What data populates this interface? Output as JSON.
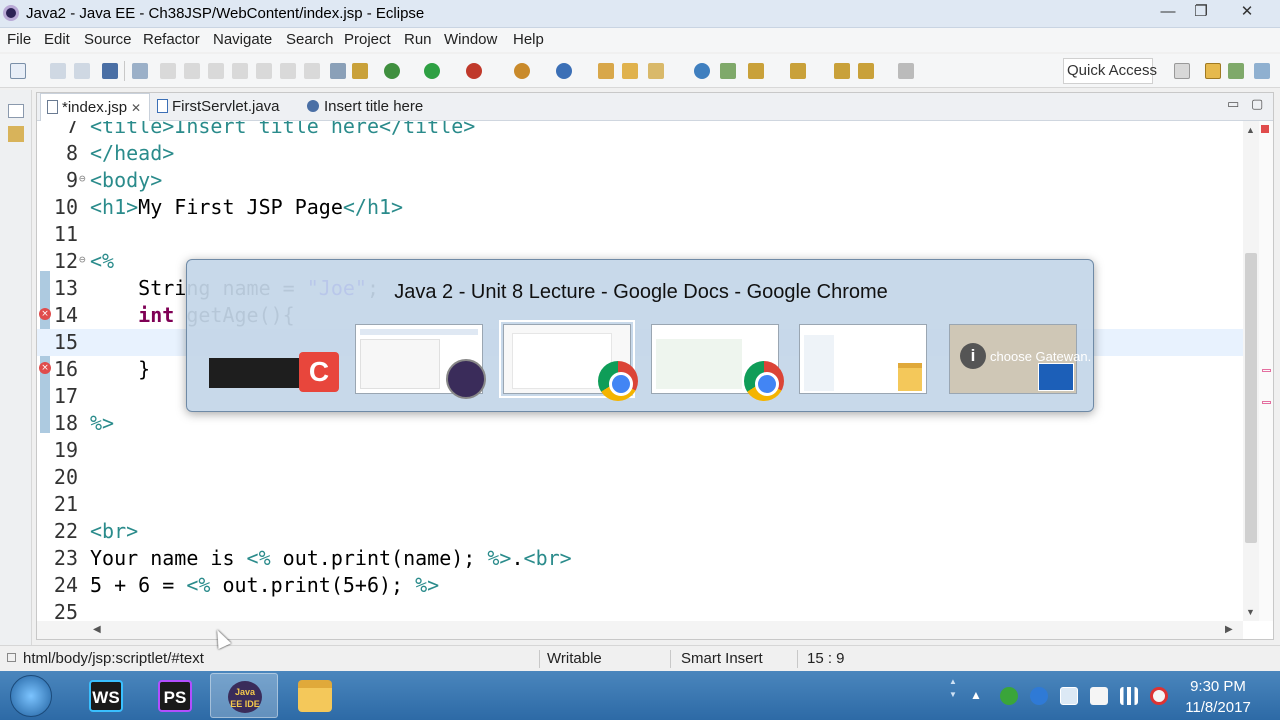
{
  "window": {
    "title": "Java2 - Java EE - Ch38JSP/WebContent/index.jsp - Eclipse",
    "controls": {
      "minimize": "—",
      "maximize": "❐",
      "close": "✕"
    }
  },
  "menu": [
    "File",
    "Edit",
    "Source",
    "Refactor",
    "Navigate",
    "Search",
    "Project",
    "Run",
    "Window",
    "Help"
  ],
  "toolbar": {
    "quick_access": "Quick Access"
  },
  "tabs": [
    {
      "label": "*index.jsp",
      "active": true,
      "close": "✕"
    },
    {
      "label": "FirstServlet.java",
      "active": false
    },
    {
      "label": "Insert title here",
      "active": false
    }
  ],
  "pane_controls": {
    "minimize": "▭",
    "maximize": "▢"
  },
  "editor": {
    "lines": [
      {
        "n": "7",
        "segments": [
          {
            "t": "<title>Insert title here</title>",
            "c": "tag"
          }
        ]
      },
      {
        "n": "8",
        "segments": [
          {
            "t": "</head>",
            "c": "tag"
          }
        ]
      },
      {
        "n": "9",
        "segments": [
          {
            "t": "<body>",
            "c": "tag"
          }
        ],
        "fold": "⊖"
      },
      {
        "n": "10",
        "segments": [
          {
            "t": "<h1>",
            "c": "tag"
          },
          {
            "t": "My First JSP Page",
            "c": "txt"
          },
          {
            "t": "</h1>",
            "c": "tag"
          }
        ]
      },
      {
        "n": "11",
        "segments": []
      },
      {
        "n": "12",
        "segments": [
          {
            "t": "<%",
            "c": "tag"
          }
        ],
        "fold": "⊖"
      },
      {
        "n": "13",
        "segments": [
          {
            "t": "    String name = ",
            "c": "txt"
          },
          {
            "t": "\"Joe\"",
            "c": "str"
          },
          {
            "t": ";",
            "c": "txt"
          }
        ]
      },
      {
        "n": "14",
        "segments": [
          {
            "t": "    ",
            "c": "txt"
          },
          {
            "t": "int",
            "c": "kw"
          },
          {
            "t": " getAge(){",
            "c": "txt"
          }
        ],
        "error": true
      },
      {
        "n": "15",
        "segments": [],
        "current": true
      },
      {
        "n": "16",
        "segments": [
          {
            "t": "    }",
            "c": "txt"
          }
        ],
        "error": true
      },
      {
        "n": "17",
        "segments": []
      },
      {
        "n": "18",
        "segments": [
          {
            "t": "%>",
            "c": "tag"
          }
        ]
      },
      {
        "n": "19",
        "segments": []
      },
      {
        "n": "20",
        "segments": []
      },
      {
        "n": "21",
        "segments": []
      },
      {
        "n": "22",
        "segments": [
          {
            "t": "<br>",
            "c": "tag"
          }
        ]
      },
      {
        "n": "23",
        "segments": [
          {
            "t": "Your name is ",
            "c": "txt"
          },
          {
            "t": "<%",
            "c": "tag"
          },
          {
            "t": " out.print(name); ",
            "c": "txt"
          },
          {
            "t": "%>",
            "c": "tag"
          },
          {
            "t": ".",
            "c": "txt"
          },
          {
            "t": "<br>",
            "c": "tag"
          }
        ]
      },
      {
        "n": "24",
        "segments": [
          {
            "t": "5 + 6 = ",
            "c": "txt"
          },
          {
            "t": "<%",
            "c": "tag"
          },
          {
            "t": " out.print(5+6); ",
            "c": "txt"
          },
          {
            "t": "%>",
            "c": "tag"
          }
        ]
      },
      {
        "n": "25",
        "segments": []
      }
    ]
  },
  "status_bar": {
    "path": "html/body/jsp:scriptlet/#text",
    "mode": "Writable",
    "insert": "Smart Insert",
    "position": "15 : 9"
  },
  "switcher": {
    "title": "Java 2 - Unit 8 Lecture - Google Docs - Google Chrome",
    "thumbnails": [
      {
        "name": "camtasia",
        "icon": "camtasia-icon"
      },
      {
        "name": "eclipse",
        "icon": "eclipse-icon"
      },
      {
        "name": "chrome-docs",
        "icon": "chrome-icon",
        "selected": true
      },
      {
        "name": "chrome-2",
        "icon": "chrome-icon"
      },
      {
        "name": "explorer",
        "icon": "folder-icon"
      },
      {
        "name": "gatewan",
        "icon": "info-icon",
        "caption": "choose Gatewan."
      }
    ]
  },
  "taskbar": {
    "apps": [
      {
        "label": "WS",
        "icon": "webstorm-icon"
      },
      {
        "label": "PS",
        "icon": "phpstorm-icon"
      },
      {
        "label": "Java EE IDE",
        "icon": "eclipse-icon",
        "active": true
      },
      {
        "label": "",
        "icon": "file-explorer-icon"
      }
    ],
    "time": "9:30 PM",
    "date": "11/8/2017"
  },
  "colors": {
    "tag": "#2a8b8b",
    "keyword": "#7f0055",
    "string": "#2a00ff",
    "taskbar": "#3a78b4"
  }
}
